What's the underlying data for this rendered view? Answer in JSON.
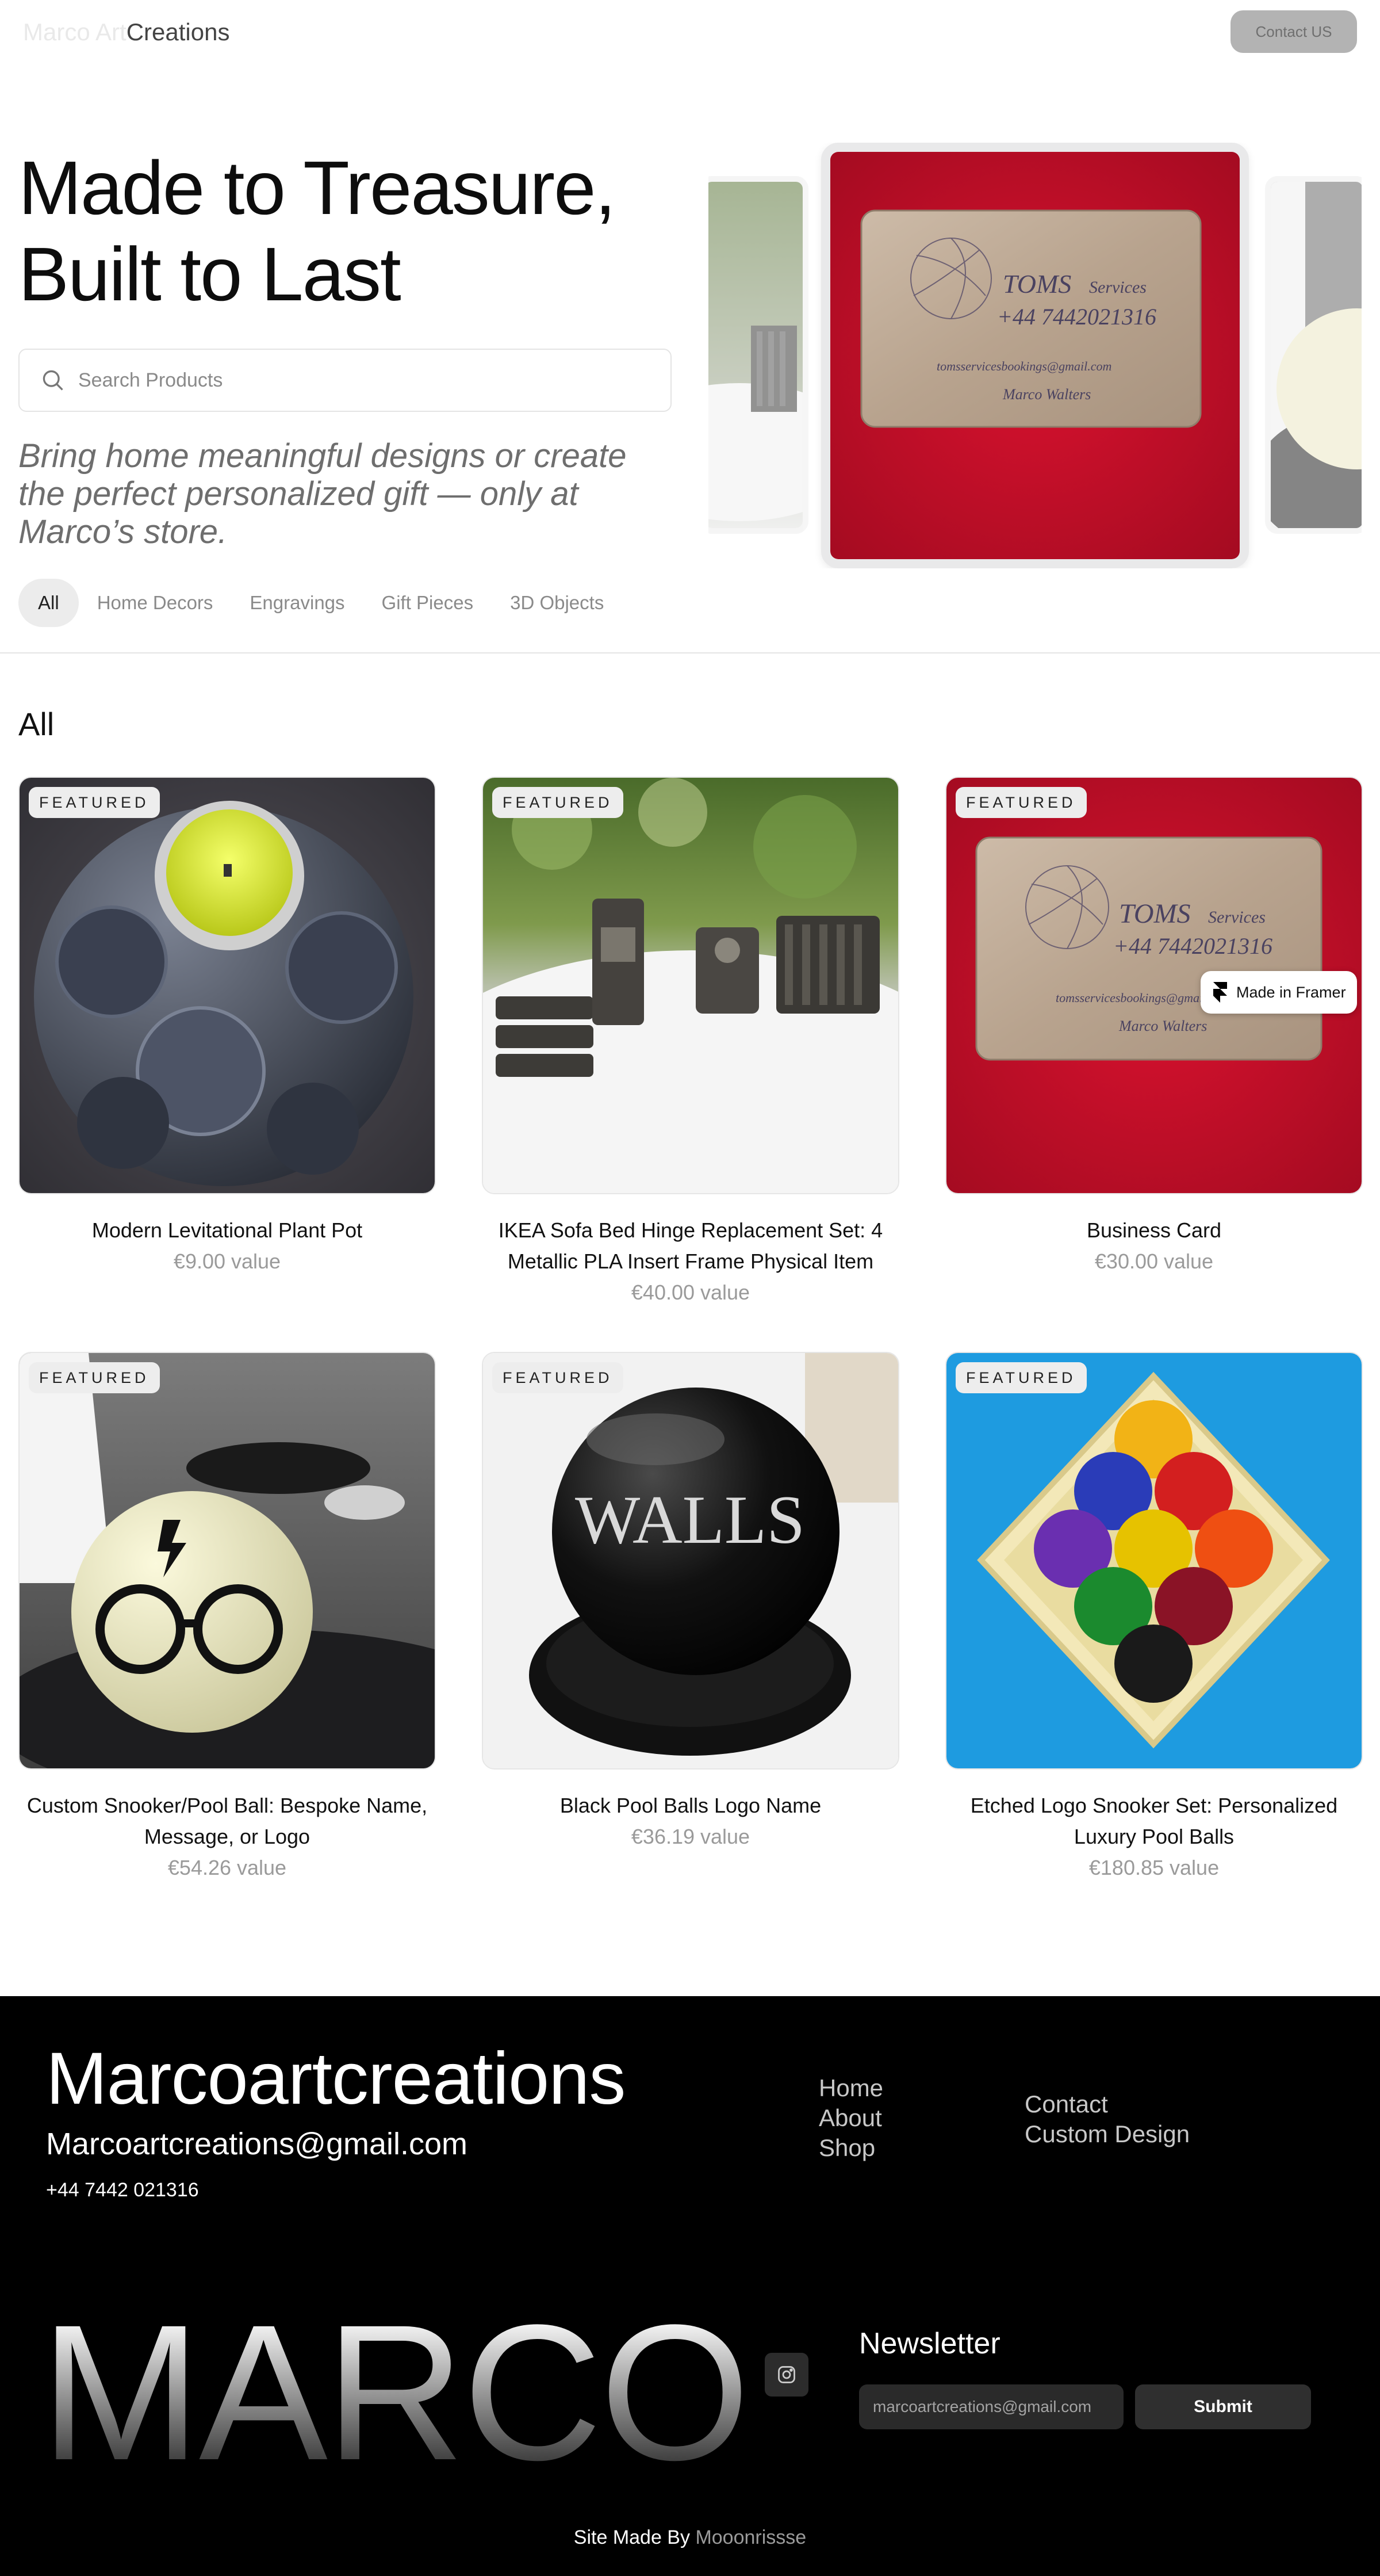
{
  "header": {
    "brand_faded": "Marco Art",
    "brand_rest": "Creations",
    "contact_label": "Contact US"
  },
  "hero": {
    "title_line1": "Made to Treasure,",
    "title_line2": "Built to Last",
    "search_placeholder": "Search Products",
    "tagline": "Bring home meaningful designs or create the perfect personalized gift — only at Marco’s store.",
    "categories": [
      "All",
      "Home Decors",
      "Engravings",
      "Gift Pieces",
      "3D Objects"
    ],
    "active_category": "All"
  },
  "section": {
    "title": "All"
  },
  "products": [
    {
      "badge": "FEATURED",
      "name": "Modern Levitational Plant Pot",
      "price": "€9.00 value"
    },
    {
      "badge": "FEATURED",
      "name": "IKEA Sofa Bed Hinge Replacement Set: 4 Metallic PLA Insert Frame Physical Item",
      "price": "€40.00 value"
    },
    {
      "badge": "FEATURED",
      "name": "Business Card",
      "price": "€30.00 value"
    },
    {
      "badge": "FEATURED",
      "name": "Custom Snooker/Pool Ball: Bespoke Name, Message, or Logo",
      "price": "€54.26 value"
    },
    {
      "badge": "FEATURED",
      "name": "Black Pool Balls Logo Name",
      "price": "€36.19 value"
    },
    {
      "badge": "FEATURED",
      "name": "Etched Logo Snooker Set: Personalized Luxury Pool Balls",
      "price": "€180.85 value"
    }
  ],
  "card_text": {
    "company": "TOMS",
    "services": "Services",
    "phone": "+44 7442021316",
    "email": "tomsservicesbookings@gmail.com",
    "signature": "Marco Walters"
  },
  "ball_text": "WALLS",
  "framer_badge": "Made in Framer",
  "footer": {
    "brand": "Marcoartcreations",
    "email": "Marcoartcreations@gmail.com",
    "phone": "+44 7442 021316",
    "links_col1": [
      "Home",
      "About",
      "Shop"
    ],
    "links_col2": [
      "Contact",
      "Custom Design"
    ],
    "big_word": "MARCO",
    "newsletter_title": "Newsletter",
    "newsletter_placeholder": "marcoartcreations@gmail.com",
    "submit_label": "Submit",
    "credit_prefix": "Site Made By",
    "credit_name": "Mooonrissse"
  },
  "icons": {
    "search": "search-icon",
    "instagram": "instagram-icon",
    "framer": "framer-logo-icon"
  },
  "colors": {
    "footer_bg": "#000000",
    "contact_btn": "#b3b3b3",
    "red_felt": "#c8102e",
    "blue_table": "#1e9be0"
  }
}
